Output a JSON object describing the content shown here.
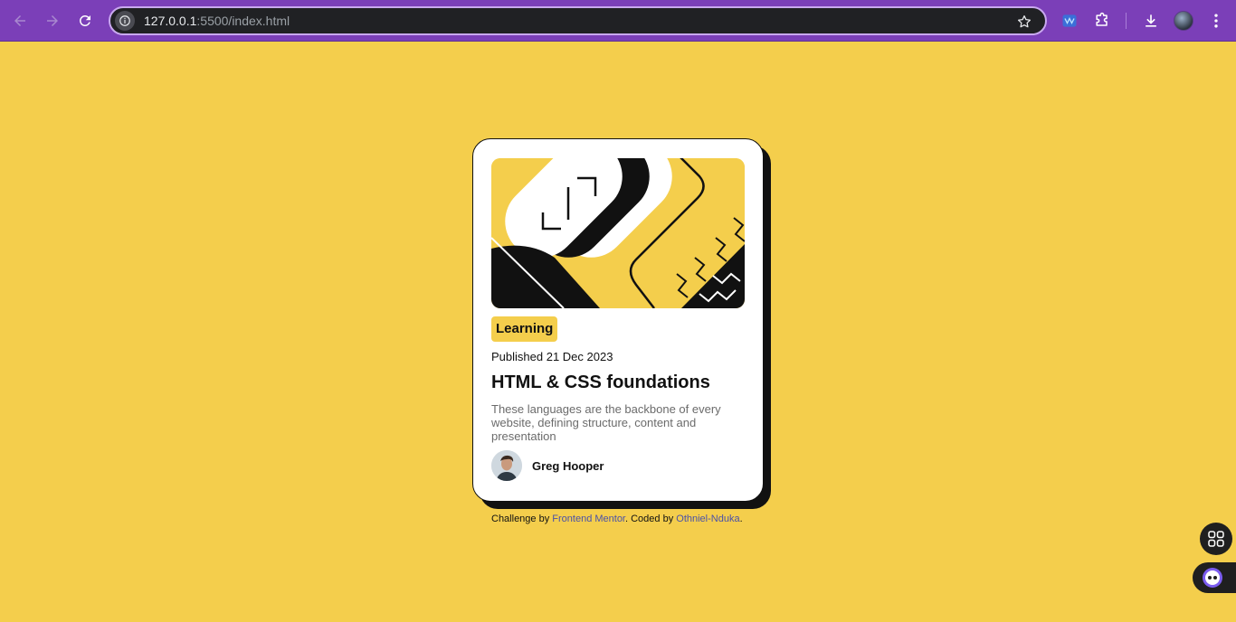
{
  "browser": {
    "url_host": "127.0.0.1",
    "url_path": ":5500/index.html",
    "icons": [
      "back-arrow-icon",
      "forward-arrow-icon",
      "reload-icon",
      "site-info-icon",
      "bookmark-star-icon",
      "extension-icon",
      "puzzle-icon",
      "download-icon",
      "profile-avatar",
      "kebab-menu-icon"
    ],
    "colors": {
      "frame": "#7b3fb8",
      "omnibox": "#202124",
      "omnibox_border": "#c9a8ef"
    }
  },
  "page": {
    "background": "#f4ce4c"
  },
  "card": {
    "tag": "Learning",
    "published": "Published 21 Dec 2023",
    "title": "HTML & CSS foundations",
    "description": "These languages are the backbone of every website, defining structure, content and presentation",
    "author": "Greg Hooper"
  },
  "attribution": {
    "prefix": "Challenge by ",
    "link1": "Frontend Mentor",
    "middle": ". Coded by ",
    "link2": "Othniel-Nduka",
    "suffix": "."
  },
  "widgets": [
    "apps-grid-icon",
    "assistant-bot-icon"
  ]
}
